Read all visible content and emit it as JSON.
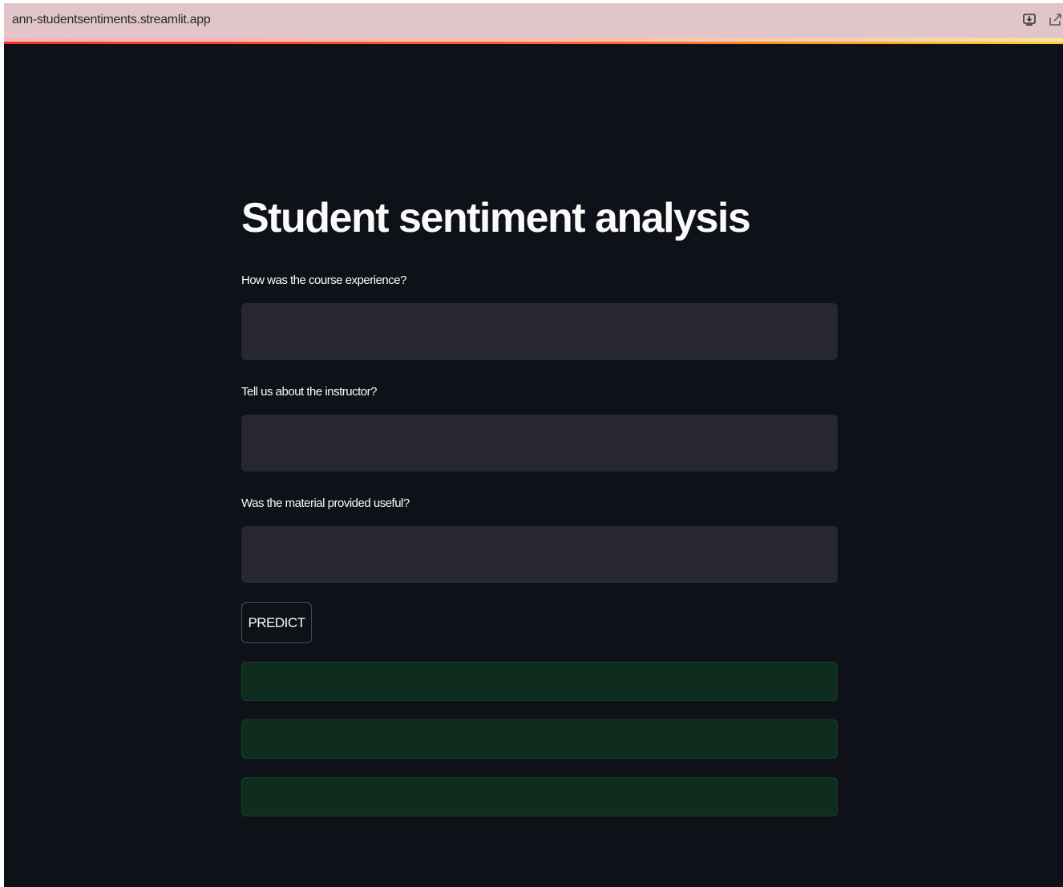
{
  "browser": {
    "url": "ann-studentsentiments.streamlit.app",
    "icons": [
      "install-app-icon",
      "share-icon"
    ]
  },
  "app": {
    "title": "Student sentiment analysis",
    "fields": [
      {
        "label": "How was the course experience?",
        "value": "",
        "placeholder": ""
      },
      {
        "label": "Tell us about the instructor?",
        "value": "",
        "placeholder": ""
      },
      {
        "label": "Was the material provided useful?",
        "value": "",
        "placeholder": ""
      }
    ],
    "predict_label": "PREDICT",
    "results": [
      "",
      "",
      ""
    ]
  },
  "colors": {
    "background": "#0e1117",
    "input_background": "#262730",
    "success_background": "#0f2d1f",
    "text": "#fafafa",
    "browser_bar": "#e1c5cb"
  }
}
